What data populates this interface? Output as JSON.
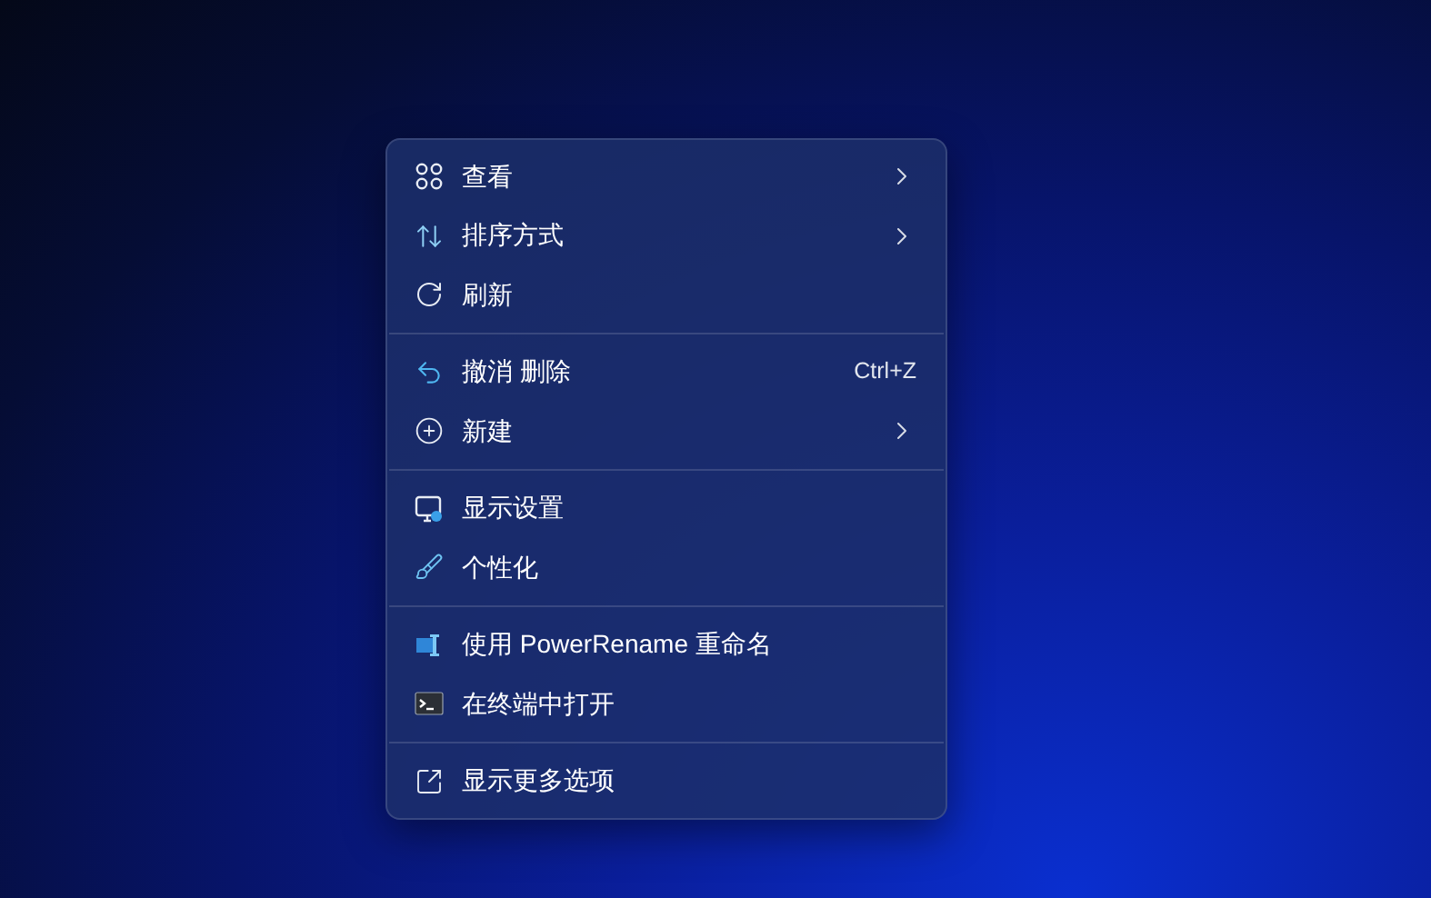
{
  "context_menu": {
    "groups": [
      {
        "items": [
          {
            "kind": "view",
            "label": "查看",
            "submenu": true
          },
          {
            "kind": "sort",
            "label": "排序方式",
            "submenu": true
          },
          {
            "kind": "refresh",
            "label": "刷新",
            "submenu": false
          }
        ]
      },
      {
        "items": [
          {
            "kind": "undo",
            "label": "撤消 删除",
            "shortcut": "Ctrl+Z",
            "submenu": false
          },
          {
            "kind": "new",
            "label": "新建",
            "submenu": true
          }
        ]
      },
      {
        "items": [
          {
            "kind": "display",
            "label": "显示设置",
            "submenu": false
          },
          {
            "kind": "personalize",
            "label": "个性化",
            "submenu": false
          }
        ]
      },
      {
        "items": [
          {
            "kind": "rename",
            "label": "使用 PowerRename 重命名",
            "submenu": false
          },
          {
            "kind": "terminal",
            "label": "在终端中打开",
            "submenu": false
          }
        ]
      },
      {
        "items": [
          {
            "kind": "more",
            "label": "显示更多选项",
            "submenu": false
          }
        ]
      }
    ]
  }
}
